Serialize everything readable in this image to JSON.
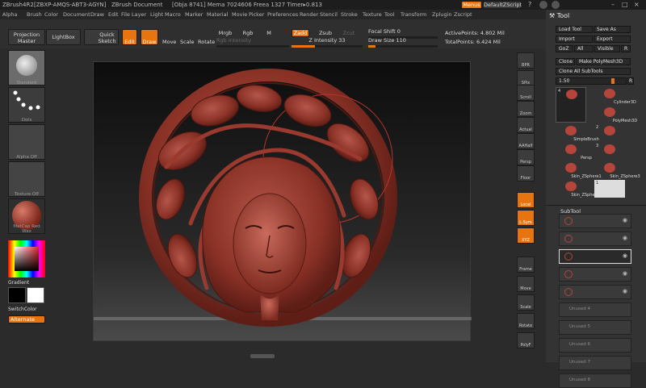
{
  "titlebar": {
    "app": "ZBrush4R2",
    "build": "[ZBXP-AMQS-ABT3-AGYN]",
    "document": "ZBrush Document",
    "stats": "[Obja 8741]  Mema 7024606  Freea 1327  Timer▸0.813",
    "menus_btn": "Menus",
    "script_btn": "DefaultZScript"
  },
  "menubar": [
    "Alpha",
    "Brush",
    "Color",
    "Document",
    "Draw",
    "Edit",
    "File",
    "Layer",
    "Light",
    "Macro",
    "Marker",
    "Material",
    "Movie",
    "Picker",
    "Preferences",
    "Render",
    "Stencil",
    "Stroke",
    "Texture",
    "Tool",
    "Transform",
    "Zplugin",
    "Zscript"
  ],
  "toolbar": {
    "projection_master": "Projection Master",
    "lightbox": "LightBox",
    "quick_sketch": "Quick Sketch",
    "edit": "Edit",
    "draw": "Draw",
    "move": "Move",
    "scale": "Scale",
    "rotate": "Rotate",
    "mrgb": "Mrgb",
    "rgb": "Rgb",
    "m": "M",
    "rgb_intensity": "Rgb Intensity",
    "zadd": "Zadd",
    "zsub": "Zsub",
    "zcut": "Zcut",
    "z_intensity": "Z Intensity 33",
    "z_intensity_value": 0.33,
    "focal_shift": "Focal Shift 0",
    "draw_size": "Draw Size 110",
    "draw_size_value": 0.11,
    "active_points": "ActivePoints: 4.802 Mil",
    "total_points": "TotalPoints: 6.424 Mil"
  },
  "leftshelf": {
    "brush": "Standard",
    "stroke": "Dots",
    "alpha": "Alpha Off",
    "texture": "Texture Off",
    "material": "MatCap Red Wax",
    "gradient": "Gradient",
    "switch_color": "SwitchColor",
    "alternate": "Alternate"
  },
  "rightshelf": [
    "BPR",
    "SPix",
    "Scroll",
    "Zoom",
    "Actual",
    "AAHalf",
    "Persp",
    "Floor",
    "Local",
    "L.Sym",
    "XYZ",
    "Frame",
    "Move",
    "Scale",
    "Rotate",
    "PolyF"
  ],
  "toolpanel": {
    "title": "Tool",
    "load_tool": "Load Tool",
    "save_as": "Save As",
    "import": "Import",
    "export": "Export",
    "goz": "GoZ",
    "all": "All",
    "visible": "Visible",
    "r": "R",
    "clone": "Clone",
    "make_polymesh": "Make PolyMesh3D",
    "clone_all": "Clone All SubTools",
    "slider_value": "1.50",
    "tools": [
      {
        "label": "",
        "num": "4"
      },
      {
        "label": "Cylinder3D",
        "num": ""
      },
      {
        "label": "",
        "num": ""
      },
      {
        "label": "PolyMesh3D",
        "num": ""
      },
      {
        "label": "SimpleBrush",
        "num": ""
      },
      {
        "label": "",
        "num": "2"
      },
      {
        "label": "Persp",
        "num": ""
      },
      {
        "label": "",
        "num": "3"
      },
      {
        "label": "Skin_ZSphere1",
        "num": ""
      },
      {
        "label": "Skin_ZSphere3",
        "num": ""
      },
      {
        "label": "Skin_ZSphere3",
        "num": ""
      },
      {
        "label": "",
        "num": "1"
      }
    ],
    "subtool_title": "SubTool",
    "subtools": [
      "",
      "",
      "",
      "",
      "",
      "Unused 4",
      "Unused 5",
      "Unused 6",
      "Unused 7",
      "Unused 8"
    ]
  }
}
